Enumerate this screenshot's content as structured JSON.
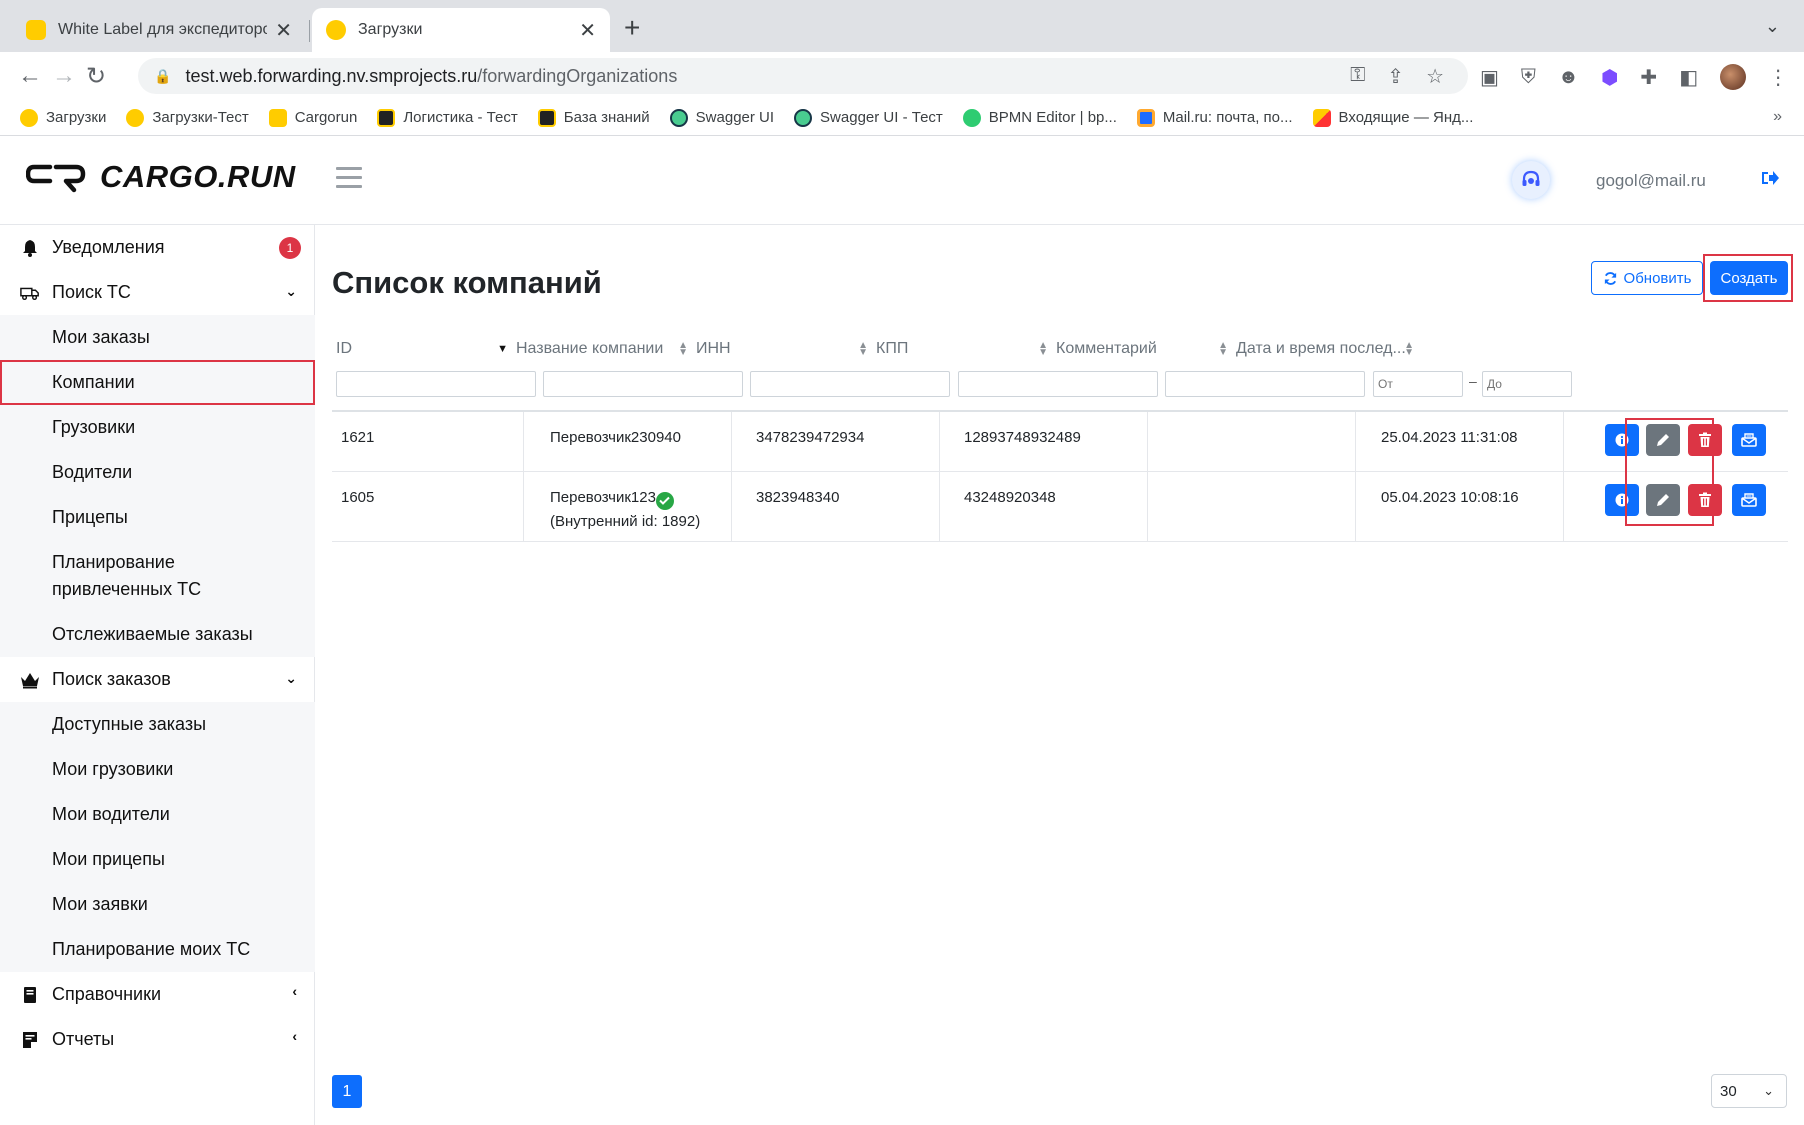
{
  "browser": {
    "tabs": [
      {
        "title": "White Label для экспедиторов",
        "active": false
      },
      {
        "title": "Загрузки",
        "active": true
      }
    ],
    "url_host": "test.web.forwarding.nv.smprojects.ru",
    "url_path": "/forwardingOrganizations",
    "bookmarks": [
      {
        "label": "Загрузки",
        "icon": "yellow-circle-icon",
        "color": "#ffcc00"
      },
      {
        "label": "Загрузки-Тест",
        "icon": "yellow-circle-icon",
        "color": "#ffcc00"
      },
      {
        "label": "Cargorun",
        "icon": "yellow-square-icon",
        "color": "#ffcc00"
      },
      {
        "label": "Логистика - Тест",
        "icon": "cargorun-logo-icon",
        "color": "#222222"
      },
      {
        "label": "База знаний",
        "icon": "cargorun-logo-icon",
        "color": "#222222"
      },
      {
        "label": "Swagger UI",
        "icon": "swagger-icon",
        "color": "#49cc90"
      },
      {
        "label": "Swagger UI - Тест",
        "icon": "swagger-icon",
        "color": "#49cc90"
      },
      {
        "label": "BPMN Editor | bp...",
        "icon": "bpmn-icon",
        "color": "#2ecc71"
      },
      {
        "label": "Mail.ru: почта, по...",
        "icon": "mailru-icon",
        "color": "#1e6cff"
      },
      {
        "label": "Входящие — Янд...",
        "icon": "yandex-mail-icon",
        "color": "#ff3333"
      }
    ],
    "bookmarks_more": "»"
  },
  "header": {
    "logo_text": "CARGO.RUN",
    "user_email": "gogol@mail.ru"
  },
  "sidebar": {
    "notifications": {
      "label": "Уведомления",
      "badge": "1"
    },
    "search_tc": {
      "label": "Поиск ТС",
      "items": [
        "Мои заказы",
        "Компании",
        "Грузовики",
        "Водители",
        "Прицепы",
        "Планирование привлеченных ТС",
        "Отслеживаемые заказы"
      ]
    },
    "search_orders": {
      "label": "Поиск заказов",
      "items": [
        "Доступные заказы",
        "Мои грузовики",
        "Мои водители",
        "Мои прицепы",
        "Мои заявки",
        "Планирование моих ТС"
      ]
    },
    "directories": {
      "label": "Справочники"
    },
    "reports": {
      "label": "Отчеты"
    }
  },
  "main": {
    "title": "Список компаний",
    "refresh_label": "Обновить",
    "create_label": "Создать",
    "columns": [
      "ID",
      "Название компании",
      "ИНН",
      "КПП",
      "Комментарий",
      "Дата и время послед..."
    ],
    "date_from_placeholder": "От",
    "date_to_placeholder": "До",
    "rows": [
      {
        "id": "1621",
        "name": "Перевозчик230940",
        "verified": false,
        "internal": "",
        "inn": "3478239472934",
        "kpp": "12893748932489",
        "comment": "",
        "date": "25.04.2023 11:31:08"
      },
      {
        "id": "1605",
        "name": "Перевозчик123",
        "verified": true,
        "internal": "(Внутренний id: 1892)",
        "inn": "3823948340",
        "kpp": "43248920348",
        "comment": "",
        "date": "05.04.2023 10:08:16"
      }
    ],
    "page": "1",
    "per_page": "30"
  },
  "colors": {
    "primary": "#0d6efd",
    "danger": "#dc3545",
    "secondary": "#6c757d",
    "success": "#28a745"
  }
}
